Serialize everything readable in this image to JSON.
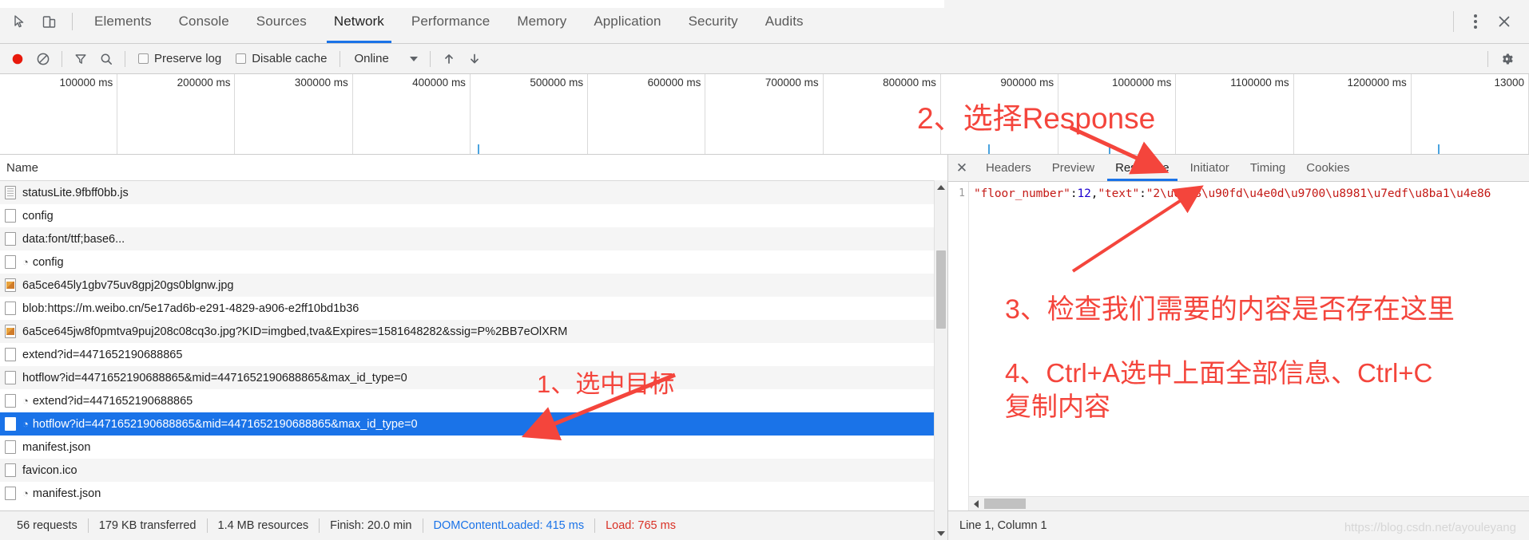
{
  "toolbar_top": {
    "icons": [
      {
        "name": "inspect-element-icon",
        "glyph": "inspect"
      },
      {
        "name": "device-toolbar-icon",
        "glyph": "device"
      }
    ],
    "tabs": [
      {
        "label": "Elements",
        "active": false
      },
      {
        "label": "Console",
        "active": false
      },
      {
        "label": "Sources",
        "active": false
      },
      {
        "label": "Network",
        "active": true
      },
      {
        "label": "Performance",
        "active": false
      },
      {
        "label": "Memory",
        "active": false
      },
      {
        "label": "Application",
        "active": false
      },
      {
        "label": "Security",
        "active": false
      },
      {
        "label": "Audits",
        "active": false
      }
    ],
    "more_label": "more-options",
    "close_label": "close-devtools"
  },
  "network_toolbar": {
    "record_icon": "record-icon",
    "clear_icon": "clear-icon",
    "filter_icon": "filter-icon",
    "search_icon": "search-icon",
    "preserve_log_label": "Preserve log",
    "preserve_log_checked": false,
    "disable_cache_label": "Disable cache",
    "disable_cache_checked": false,
    "throttle_value": "Online",
    "import_icon": "upload-har-icon",
    "export_icon": "download-har-icon",
    "settings_icon": "gear-icon"
  },
  "overview": {
    "ticks": [
      "100000 ms",
      "200000 ms",
      "300000 ms",
      "400000 ms",
      "500000 ms",
      "600000 ms",
      "700000 ms",
      "800000 ms",
      "900000 ms",
      "1000000 ms",
      "1100000 ms",
      "1200000 ms",
      "13000"
    ]
  },
  "requests": {
    "column_header": "Name",
    "rows": [
      {
        "name": "statusLite.9fbff0bb.js",
        "icon": "js-file-icon",
        "clock": false,
        "selected": false
      },
      {
        "name": "config",
        "icon": "doc-file-icon",
        "clock": false,
        "selected": false
      },
      {
        "name": "data:font/ttf;base6...",
        "icon": "doc-file-icon",
        "clock": false,
        "selected": false
      },
      {
        "name": "config",
        "icon": "doc-file-icon",
        "clock": true,
        "selected": false
      },
      {
        "name": "6a5ce645ly1gbv75uv8gpj20gs0blgnw.jpg",
        "icon": "image-file-icon",
        "clock": false,
        "selected": false
      },
      {
        "name": "blob:https://m.weibo.cn/5e17ad6b-e291-4829-a906-e2ff10bd1b36",
        "icon": "doc-file-icon",
        "clock": false,
        "selected": false
      },
      {
        "name": "6a5ce645jw8f0pmtva9puj208c08cq3o.jpg?KID=imgbed,tva&Expires=1581648282&ssig=P%2BB7eOlXRM",
        "icon": "image-file-icon",
        "clock": false,
        "selected": false
      },
      {
        "name": "extend?id=4471652190688865",
        "icon": "doc-file-icon",
        "clock": false,
        "selected": false
      },
      {
        "name": "hotflow?id=4471652190688865&mid=4471652190688865&max_id_type=0",
        "icon": "doc-file-icon",
        "clock": false,
        "selected": false
      },
      {
        "name": "extend?id=4471652190688865",
        "icon": "doc-file-icon",
        "clock": true,
        "selected": false
      },
      {
        "name": "hotflow?id=4471652190688865&mid=4471652190688865&max_id_type=0",
        "icon": "doc-file-icon",
        "clock": true,
        "selected": true
      },
      {
        "name": "manifest.json",
        "icon": "doc-file-icon",
        "clock": false,
        "selected": false
      },
      {
        "name": "favicon.ico",
        "icon": "doc-file-icon",
        "clock": false,
        "selected": false
      },
      {
        "name": "manifest.json",
        "icon": "doc-file-icon",
        "clock": true,
        "selected": false
      }
    ]
  },
  "status_bar": {
    "requests": "56 requests",
    "transferred": "179 KB transferred",
    "resources": "1.4 MB resources",
    "finish": "Finish: 20.0 min",
    "dom_content_loaded": "DOMContentLoaded: 415 ms",
    "load": "Load: 765 ms"
  },
  "detail_panel": {
    "close_glyph": "✕",
    "tabs": [
      {
        "label": "Headers",
        "active": false
      },
      {
        "label": "Preview",
        "active": false
      },
      {
        "label": "Response",
        "active": true
      },
      {
        "label": "Initiator",
        "active": false
      },
      {
        "label": "Timing",
        "active": false
      },
      {
        "label": "Cookies",
        "active": false
      }
    ],
    "line_number": "1",
    "response_segments": [
      {
        "text": "\"floor_number\"",
        "kind": "string"
      },
      {
        "text": ":",
        "kind": "punc"
      },
      {
        "text": "12",
        "kind": "num"
      },
      {
        "text": ",",
        "kind": "punc"
      },
      {
        "text": "\"text\"",
        "kind": "string"
      },
      {
        "text": ":",
        "kind": "punc"
      },
      {
        "text": "\"2\\u6708\\u90fd\\u4e0d\\u9700\\u8981\\u7edf\\u8ba1\\u4e86",
        "kind": "string"
      }
    ],
    "cursor_status": "Line 1, Column 1"
  },
  "annotations": {
    "step1": "1、选中目标",
    "step2": "2、选择Response",
    "step3": "3、检查我们需要的内容是否存在这里",
    "step4": "4、Ctrl+A选中上面全部信息、Ctrl+C\n复制内容",
    "accent_color": "#f4453c"
  },
  "watermark": "https://blog.csdn.net/ayouleyang"
}
